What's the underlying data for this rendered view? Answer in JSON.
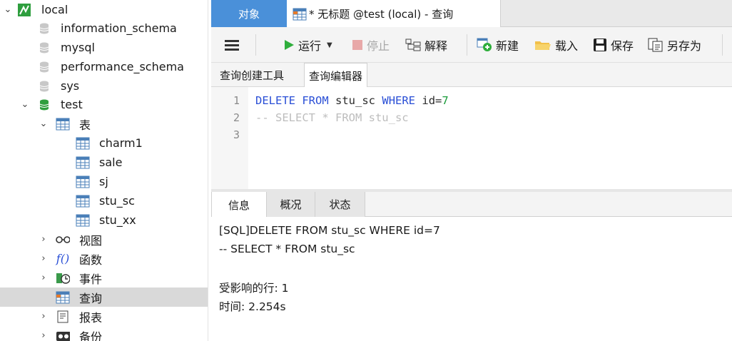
{
  "tree": {
    "connection": "local",
    "databases": [
      "information_schema",
      "mysql",
      "performance_schema",
      "sys"
    ],
    "open_db": "test",
    "tables_label": "表",
    "tables": [
      "charm1",
      "sale",
      "sj",
      "stu_sc",
      "stu_xx"
    ],
    "views_label": "视图",
    "functions_label": "函数",
    "events_label": "事件",
    "queries_label": "查询",
    "reports_label": "报表",
    "backups_label": "备份"
  },
  "tabs": {
    "objects": "对象",
    "query_tab": "* 无标题 @test (local) - 查询"
  },
  "toolbar": {
    "run": "运行",
    "stop": "停止",
    "explain": "解释",
    "new": "新建",
    "load": "载入",
    "save": "保存",
    "save_as": "另存为"
  },
  "subtabs": {
    "builder": "查询创建工具",
    "editor": "查询编辑器"
  },
  "editor": {
    "line_numbers": [
      "1",
      "2",
      "3"
    ],
    "line1": {
      "kw1": "DELETE",
      "kw2": "FROM",
      "table": "stu_sc",
      "kw3": "WHERE",
      "cond": "id=",
      "value": "7"
    },
    "line2": "-- SELECT * FROM stu_sc"
  },
  "output_tabs": {
    "info": "信息",
    "overview": "概况",
    "status": "状态"
  },
  "output": {
    "line1": "[SQL]DELETE FROM stu_sc WHERE id=7",
    "line2": "-- SELECT * FROM stu_sc",
    "affected": "受影响的行: 1",
    "time": "时间: 2.254s"
  },
  "colors": {
    "accent_tab": "#4a90d9",
    "keyword": "#2a4fd6",
    "number": "#1a9c3a",
    "comment": "#bdbdbd",
    "db_open": "#2e9e3e"
  }
}
